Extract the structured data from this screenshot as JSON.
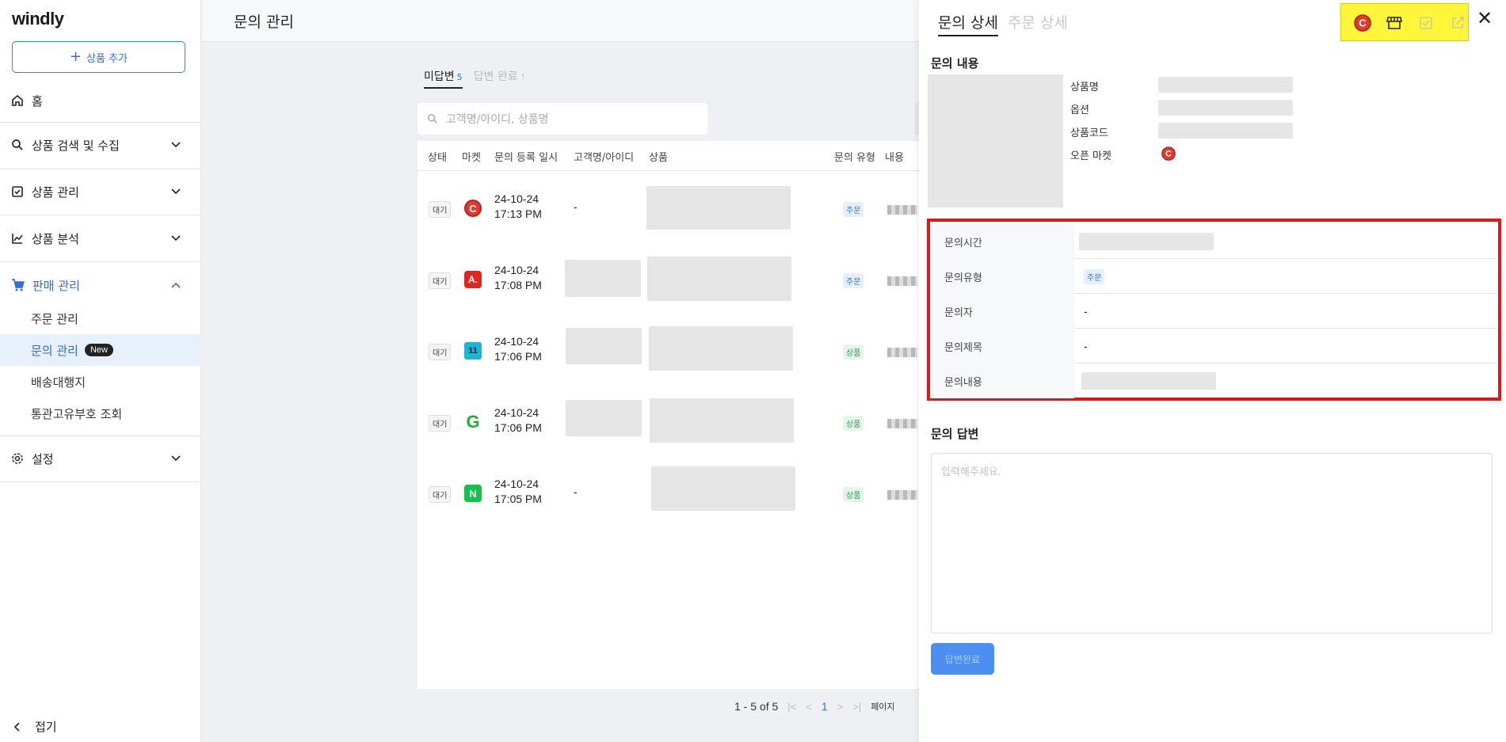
{
  "sidebar": {
    "logo": "windly",
    "add_product": "상품 추가",
    "nav": {
      "home": "홈",
      "search": "상품 검색 및 수집",
      "manage": "상품 관리",
      "analysis": "상품 분석",
      "sales": "판매 관리",
      "settings": "설정"
    },
    "sub": {
      "orders": "주문 관리",
      "inquiries": "문의 관리",
      "new_badge": "New",
      "shipping": "배송대행지",
      "customs": "통관고유부호 조회"
    },
    "collapse": "접기"
  },
  "header": {
    "title": "문의 관리"
  },
  "list": {
    "tab_unanswered": "미답변",
    "tab_unanswered_count": "5",
    "tab_answered": "답변 완료",
    "tab_answered_count": "!",
    "search_placeholder": "고객명/아이디, 상품명",
    "columns": {
      "status": "상태",
      "market": "마켓",
      "date": "문의 등록 일시",
      "customer": "고객명/아이디",
      "product": "상품",
      "type": "문의 유형",
      "content": "내용"
    },
    "rows": [
      {
        "status": "대기",
        "market_glyph": "C",
        "market_color": "#e03a2f",
        "date": "24-10-24",
        "time": "17:13 PM",
        "customer": "-",
        "type": "주문"
      },
      {
        "status": "대기",
        "market_glyph": "A.",
        "market_color": "#e0261f",
        "date": "24-10-24",
        "time": "17:08 PM",
        "customer": "",
        "type": "주문"
      },
      {
        "status": "대기",
        "market_glyph": "11",
        "market_color": "#18b6d8",
        "date": "24-10-24",
        "time": "17:06 PM",
        "customer": "",
        "type": "상품"
      },
      {
        "status": "대기",
        "market_glyph": "G",
        "market_color": "#1fae3a",
        "date": "24-10-24",
        "time": "17:06 PM",
        "customer": "",
        "type": "상품"
      },
      {
        "status": "대기",
        "market_glyph": "N",
        "market_color": "#13c24a",
        "date": "24-10-24",
        "time": "17:05 PM",
        "customer": "-",
        "type": "상품"
      }
    ],
    "pager": {
      "range": "1 - 5 of 5",
      "current": "1",
      "page_size_label": "페이지"
    }
  },
  "panel": {
    "tab_inquiry": "문의 상세",
    "tab_order": "주문 상세",
    "section_content": "문의 내용",
    "info": {
      "product_name": "상품명",
      "option": "옵션",
      "product_code": "상품코드",
      "open_market": "오픈 마켓"
    },
    "details": {
      "time_label": "문의시간",
      "type_label": "문의유형",
      "type_value": "주문",
      "asker_label": "문의자",
      "asker_value": "-",
      "subject_label": "문의제목",
      "subject_value": "-",
      "body_label": "문의내용"
    },
    "section_answer": "문의 답변",
    "answer_placeholder": "입력해주세요.",
    "submit": "답변완료"
  }
}
